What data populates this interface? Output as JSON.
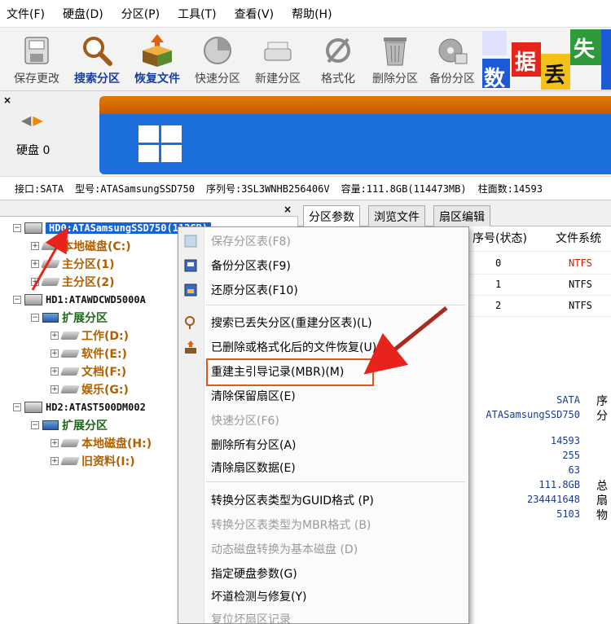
{
  "menu": [
    "文件(F)",
    "硬盘(D)",
    "分区(P)",
    "工具(T)",
    "查看(V)",
    "帮助(H)"
  ],
  "toolbar": {
    "buttons": [
      {
        "label": "保存更改",
        "icon": "save-icon",
        "style": "gray"
      },
      {
        "label": "搜索分区",
        "icon": "magnifier-icon",
        "style": "blue"
      },
      {
        "label": "恢复文件",
        "icon": "restore-box-icon",
        "style": "blue"
      },
      {
        "label": "快速分区",
        "icon": "quick-partition-icon",
        "style": "gray"
      },
      {
        "label": "新建分区",
        "icon": "new-partition-icon",
        "style": "gray"
      },
      {
        "label": "格式化",
        "icon": "format-icon",
        "style": "gray"
      },
      {
        "label": "删除分区",
        "icon": "trash-icon",
        "style": "gray"
      },
      {
        "label": "备份分区",
        "icon": "backup-icon",
        "style": "gray"
      }
    ],
    "banner_chars": [
      "数",
      "据",
      "丢",
      "失"
    ]
  },
  "disk_panel": {
    "disk_label": "硬盘 0"
  },
  "info": {
    "interface": "接口:SATA",
    "model": "型号:ATASamsungSSD750",
    "serial": "序列号:3SL3WNHB256406V",
    "capacity": "容量:111.8GB(114473MB)",
    "cylinders": "柱面数:14593"
  },
  "tree": {
    "hd0": "HD0:ATASamsungSSD750(112GB)",
    "hd0_parts": [
      "本地磁盘(C:)",
      "主分区(1)",
      "主分区(2)"
    ],
    "hd1": "HD1:ATAWDCWD5000A",
    "hd1_ext": "扩展分区",
    "hd1_parts": [
      "工作(D:)",
      "软件(E:)",
      "文档(F:)",
      "娱乐(G:)"
    ],
    "hd2": "HD2:ATAST500DM002",
    "hd2_ext": "扩展分区",
    "hd2_parts": [
      "本地磁盘(H:)",
      "旧资料(I:)"
    ]
  },
  "tabs": [
    "分区参数",
    "浏览文件",
    "扇区编辑"
  ],
  "table": {
    "headers": [
      "序号(状态)",
      "文件系统"
    ],
    "rows": [
      {
        "num": "0",
        "fs": "NTFS"
      },
      {
        "num": "1",
        "fs": "NTFS"
      },
      {
        "num": "2",
        "fs": "NTFS"
      }
    ]
  },
  "details": {
    "iface": "SATA",
    "model": "ATASamsungSSD750",
    "cut1": "序",
    "cut2": "分",
    "cylinders": "14593",
    "heads": "255",
    "sectors": "63",
    "capacity": "111.8GB",
    "total_sectors": "234441648",
    "extra": "5103",
    "cut3": "总",
    "cut4": "扇",
    "cut5": "物"
  },
  "context_menu": {
    "items": [
      {
        "label": "保存分区表(F8)",
        "disabled": true
      },
      {
        "label": "备份分区表(F9)",
        "disabled": false
      },
      {
        "label": "还原分区表(F10)",
        "disabled": false
      },
      {
        "label": "搜索已丢失分区(重建分区表)(L)",
        "disabled": false
      },
      {
        "label": "已删除或格式化后的文件恢复(U)",
        "disabled": false
      },
      {
        "label": "重建主引导记录(MBR)(M)",
        "disabled": false
      },
      {
        "label": "清除保留扇区(E)",
        "disabled": false
      },
      {
        "label": "快速分区(F6)",
        "disabled": true
      },
      {
        "label": "删除所有分区(A)",
        "disabled": false
      },
      {
        "label": "清除扇区数据(E)",
        "disabled": false
      },
      {
        "label": "转换分区表类型为GUID格式 (P)",
        "disabled": false
      },
      {
        "label": "转换分区表类型为MBR格式 (B)",
        "disabled": true
      },
      {
        "label": "动态磁盘转换为基本磁盘 (D)",
        "disabled": true
      },
      {
        "label": "指定硬盘参数(G)",
        "disabled": false
      },
      {
        "label": "坏道检测与修复(Y)",
        "disabled": false
      },
      {
        "label": "复位坏扇区记录",
        "disabled": true
      }
    ]
  },
  "colors": {
    "accent_blue": "#1464d2",
    "highlight_orange": "#e2571e",
    "annotation_red": "#e8231c"
  }
}
